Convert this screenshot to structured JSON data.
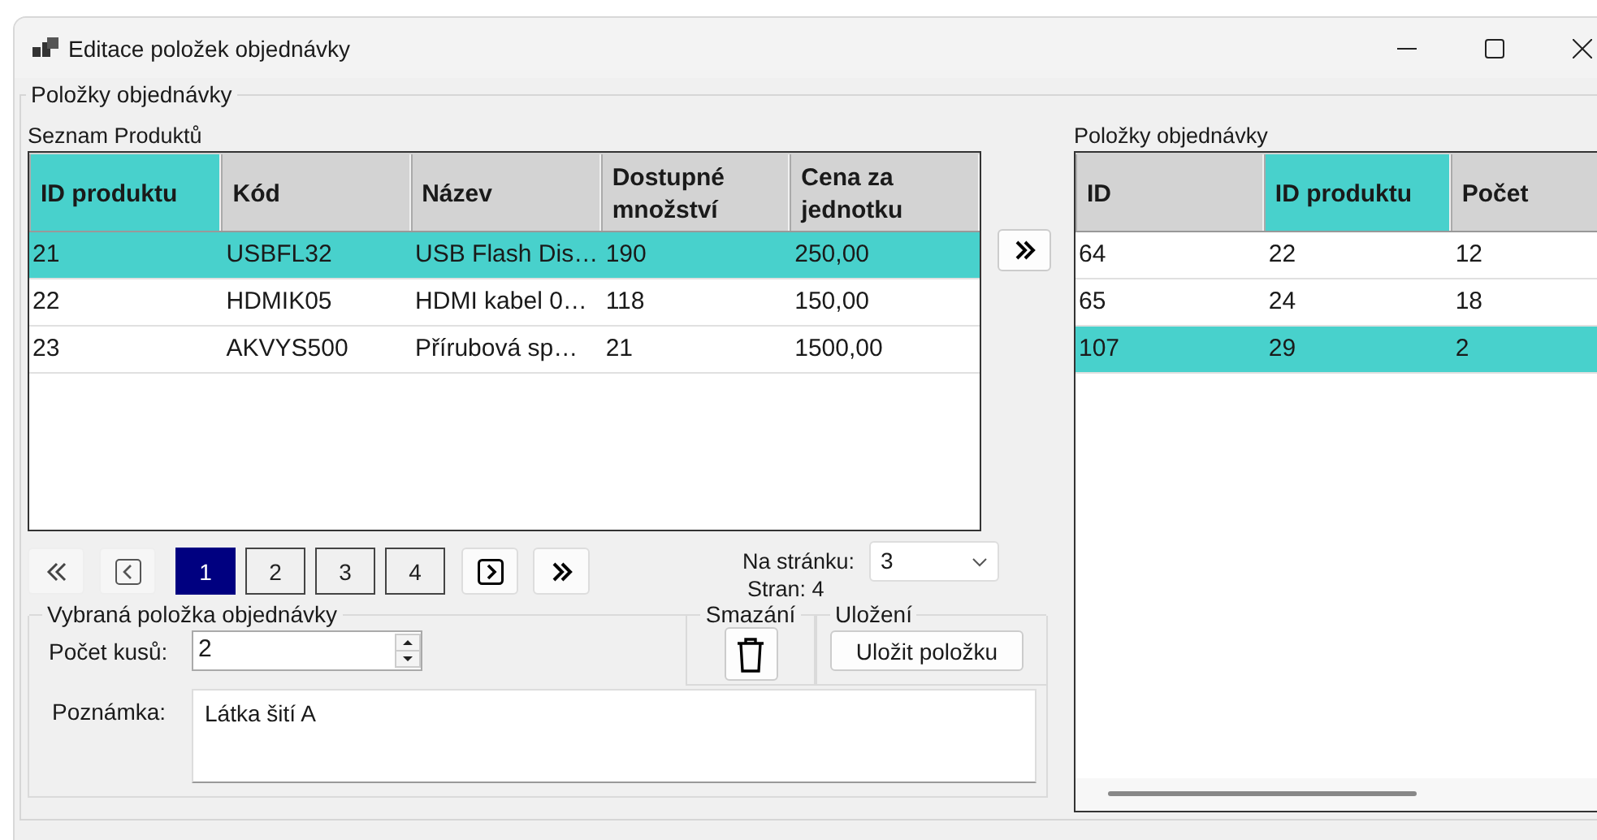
{
  "window": {
    "title": "Editace položek objednávky"
  },
  "group_title": "Položky objednávky",
  "products": {
    "label": "Seznam Produktů",
    "columns": [
      {
        "label": "ID produktu",
        "selected": true
      },
      {
        "label": "Kód",
        "selected": false
      },
      {
        "label": "Název",
        "selected": false
      },
      {
        "label": "Dostupné množství",
        "selected": false
      },
      {
        "label": "Cena za jednotku",
        "selected": false
      }
    ],
    "rows": [
      {
        "cells": [
          "21",
          "USBFL32",
          "USB Flash Dis…",
          "190",
          "250,00"
        ],
        "selected": true
      },
      {
        "cells": [
          "22",
          "HDMIK05",
          "HDMI kabel 0…",
          "118",
          "150,00"
        ],
        "selected": false
      },
      {
        "cells": [
          "23",
          "AKVYS500",
          "Přírubová sp…",
          "21",
          "1500,00"
        ],
        "selected": false
      }
    ]
  },
  "pager": {
    "pages": [
      {
        "label": "1",
        "selected": true
      },
      {
        "label": "2",
        "selected": false
      },
      {
        "label": "3",
        "selected": false
      },
      {
        "label": "4",
        "selected": false
      }
    ],
    "per_page_label": "Na stránku:",
    "per_page": "3",
    "page_count": "Stran: 4"
  },
  "selected_item": {
    "title": "Vybraná položka objednávky",
    "quantity_label": "Počet kusů:",
    "quantity": "2",
    "note_label": "Poznámka:",
    "note": "Látka šití A"
  },
  "delete_group": {
    "title": "Smazání"
  },
  "save_group": {
    "title": "Uložení",
    "button": "Uložit položku"
  },
  "order_items": {
    "label": "Položky objednávky",
    "columns": [
      {
        "label": "ID",
        "selected": false
      },
      {
        "label": "ID produktu",
        "selected": true
      },
      {
        "label": "Počet",
        "selected": false
      }
    ],
    "rows": [
      {
        "cells": [
          "64",
          "22",
          "12"
        ],
        "selected": false
      },
      {
        "cells": [
          "65",
          "24",
          "18"
        ],
        "selected": false
      },
      {
        "cells": [
          "107",
          "29",
          "2"
        ],
        "selected": true
      }
    ]
  }
}
